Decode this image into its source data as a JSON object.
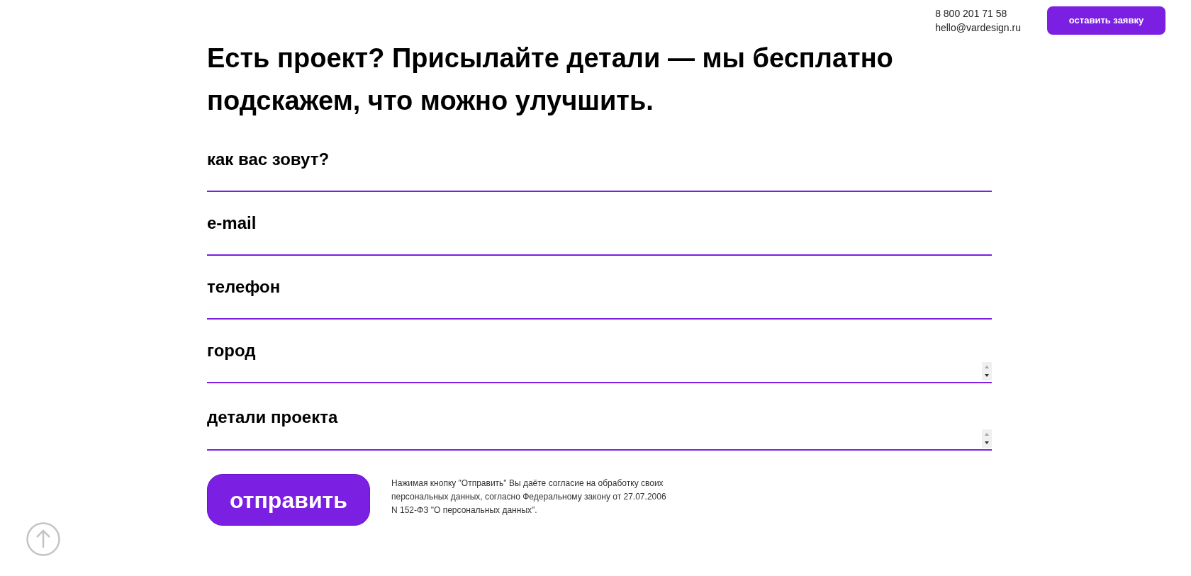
{
  "header": {
    "phone": "8 800 201 71 58",
    "email": "hello@vardesign.ru",
    "cta_button": "оставить заявку"
  },
  "heading": "Есть проект? Присылайте детали — мы бесплатно подскажем, что можно улучшить.",
  "form": {
    "fields": [
      {
        "kind": "input",
        "placeholder": "как вас зовут?"
      },
      {
        "kind": "input",
        "placeholder": "e-mail"
      },
      {
        "kind": "input",
        "placeholder": "телефон"
      },
      {
        "kind": "textarea",
        "placeholder": "город"
      },
      {
        "kind": "textarea",
        "placeholder": "детали проекта"
      }
    ],
    "submit_button": "отправить",
    "consent_text": "Нажимая кнопку \"Отправить\" Вы даёте согласие на обработку своих персональных данных, согласно Федеральному закону от 27.07.2006 N 152-ФЗ \"О персональных данных\"."
  }
}
